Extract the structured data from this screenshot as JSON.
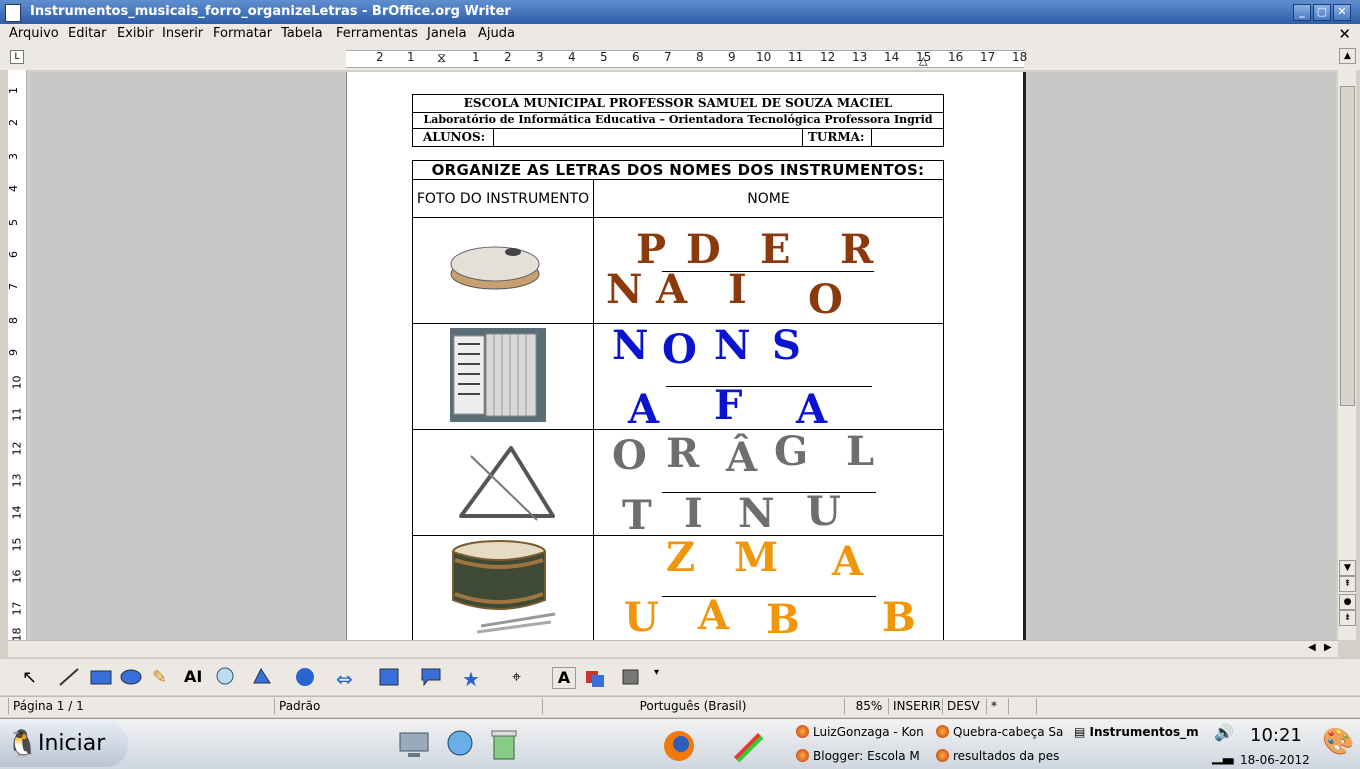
{
  "window": {
    "title": "Instrumentos_musicais_forro_organizeLetras - BrOffice.org Writer"
  },
  "menu": [
    "Arquivo",
    "Editar",
    "Exibir",
    "Inserir",
    "Formatar",
    "Tabela",
    "Ferramentas",
    "Janela",
    "Ajuda"
  ],
  "ruler": {
    "h": [
      "2",
      "1",
      "1",
      "2",
      "3",
      "4",
      "5",
      "6",
      "7",
      "8",
      "9",
      "10",
      "11",
      "12",
      "13",
      "14",
      "15",
      "16",
      "17",
      "18"
    ],
    "v": [
      "1",
      "2",
      "3",
      "4",
      "5",
      "6",
      "7",
      "8",
      "9",
      "10",
      "11",
      "12",
      "13",
      "14",
      "15",
      "16",
      "17",
      "18"
    ]
  },
  "document": {
    "school": "ESCOLA MUNICIPAL PROFESSOR SAMUEL DE SOUZA MACIEL",
    "lab": "Laboratório de Informática Educativa – Orientadora Tecnológica Professora Ingrid",
    "alunos_label": "ALUNOS:",
    "turma_label": "TURMA:",
    "task_title": "ORGANIZE AS LETRAS DOS NOMES DOS INSTRUMENTOS:",
    "col_photo": "FOTO DO INSTRUMENTO",
    "col_name": "NOME",
    "rows": [
      {
        "instrument_icon": "tambourine-icon",
        "color": "#8b3a0e",
        "line1": [
          "P",
          "D",
          "E",
          "R"
        ],
        "line2": [
          "N",
          "A",
          "I",
          "O"
        ]
      },
      {
        "instrument_icon": "accordion-icon",
        "color": "#0a14d0",
        "line1": [
          "N",
          "O",
          "N",
          "S"
        ],
        "line2": [
          "A",
          "F",
          "A"
        ]
      },
      {
        "instrument_icon": "triangle-icon",
        "color": "#6e6e6e",
        "line1": [
          "O",
          "R",
          "Â",
          "G",
          "L"
        ],
        "line2": [
          "T",
          "I",
          "N",
          "U"
        ]
      },
      {
        "instrument_icon": "drum-icon",
        "color": "#f0960a",
        "line1": [
          "Z",
          "M",
          "A"
        ],
        "line2": [
          "U",
          "A",
          "B",
          "B"
        ]
      }
    ]
  },
  "statusbar": {
    "page": "Página 1 / 1",
    "style": "Padrão",
    "language": "Português (Brasil)",
    "zoom": "85%",
    "insert": "INSERIR",
    "select": "DESV",
    "modified": "*"
  },
  "taskbar": {
    "start": "Iniciar",
    "tasks": [
      "LuizGonzaga - Kon",
      "Quebra-cabeça Sa",
      "Instrumentos_m",
      "Blogger: Escola M",
      "resultados da pes"
    ],
    "clock": "10:21",
    "date": "18-06-2012"
  }
}
